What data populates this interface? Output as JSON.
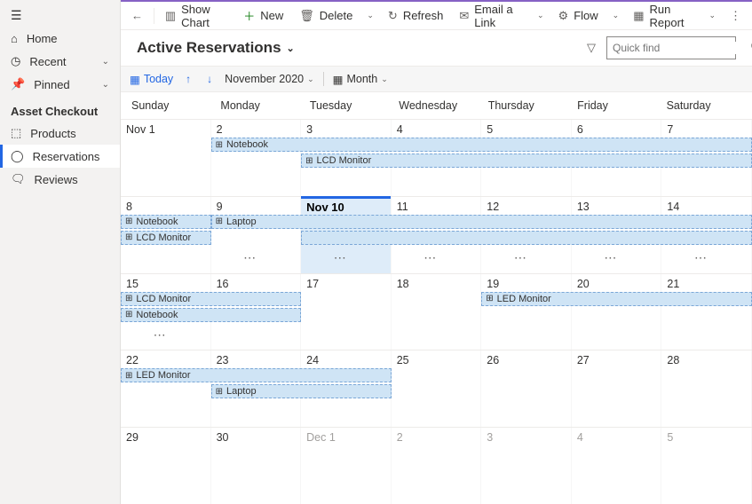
{
  "sidebar": {
    "top": [
      {
        "icon": "hamburger",
        "label": ""
      },
      {
        "icon": "home",
        "label": "Home"
      },
      {
        "icon": "clock",
        "label": "Recent",
        "expandable": true
      },
      {
        "icon": "pin",
        "label": "Pinned",
        "expandable": true
      }
    ],
    "section_title": "Asset Checkout",
    "items": [
      {
        "icon": "cube",
        "label": "Products"
      },
      {
        "icon": "check-circle",
        "label": "Reservations",
        "active": true
      },
      {
        "icon": "comment",
        "label": "Reviews"
      }
    ]
  },
  "commands": {
    "back": "←",
    "show_chart": "Show Chart",
    "new": "New",
    "delete": "Delete",
    "refresh": "Refresh",
    "email": "Email a Link",
    "flow": "Flow",
    "run_report": "Run Report"
  },
  "title": "Active Reservations",
  "search_placeholder": "Quick find",
  "calbar": {
    "today": "Today",
    "period": "November 2020",
    "view": "Month"
  },
  "day_headers": [
    "Sunday",
    "Monday",
    "Tuesday",
    "Wednesday",
    "Thursday",
    "Friday",
    "Saturday"
  ],
  "weeks": [
    {
      "cells": [
        {
          "label": "Nov 1"
        },
        {
          "label": "2"
        },
        {
          "label": "3"
        },
        {
          "label": "4"
        },
        {
          "label": "5"
        },
        {
          "label": "6"
        },
        {
          "label": "7"
        }
      ],
      "events": [
        {
          "label": "Notebook",
          "col_start": 1,
          "col_end": 7,
          "row": 0
        },
        {
          "label": "LCD Monitor",
          "col_start": 2,
          "col_end": 7,
          "row": 1
        }
      ]
    },
    {
      "cells": [
        {
          "label": "8"
        },
        {
          "label": "9"
        },
        {
          "label": "Nov 10",
          "today": true
        },
        {
          "label": "11"
        },
        {
          "label": "12"
        },
        {
          "label": "13"
        },
        {
          "label": "14"
        }
      ],
      "events": [
        {
          "label": "Notebook",
          "col_start": 0,
          "col_end": 1,
          "row": 0
        },
        {
          "label": "Laptop",
          "col_start": 1,
          "col_end": 7,
          "row": 0
        },
        {
          "label": "LCD Monitor",
          "col_start": 0,
          "col_end": 1,
          "row": 1
        },
        {
          "label": "",
          "col_start": 2,
          "col_end": 7,
          "row": 1,
          "blank": true
        }
      ],
      "more_cols": [
        1,
        2,
        3,
        4,
        5,
        6
      ]
    },
    {
      "cells": [
        {
          "label": "15"
        },
        {
          "label": "16"
        },
        {
          "label": "17"
        },
        {
          "label": "18"
        },
        {
          "label": "19"
        },
        {
          "label": "20"
        },
        {
          "label": "21"
        }
      ],
      "events": [
        {
          "label": "LCD Monitor",
          "col_start": 0,
          "col_end": 2,
          "row": 0
        },
        {
          "label": "LED Monitor",
          "col_start": 4,
          "col_end": 7,
          "row": 0
        },
        {
          "label": "Notebook",
          "col_start": 0,
          "col_end": 2,
          "row": 1
        }
      ],
      "more_cols": [
        0
      ]
    },
    {
      "cells": [
        {
          "label": "22"
        },
        {
          "label": "23"
        },
        {
          "label": "24"
        },
        {
          "label": "25"
        },
        {
          "label": "26"
        },
        {
          "label": "27"
        },
        {
          "label": "28"
        }
      ],
      "events": [
        {
          "label": "LED Monitor",
          "col_start": 0,
          "col_end": 3,
          "row": 0
        },
        {
          "label": "Laptop",
          "col_start": 1,
          "col_end": 3,
          "row": 1
        }
      ]
    },
    {
      "cells": [
        {
          "label": "29"
        },
        {
          "label": "30"
        },
        {
          "label": "Dec 1",
          "other": true
        },
        {
          "label": "2",
          "other": true
        },
        {
          "label": "3",
          "other": true
        },
        {
          "label": "4",
          "other": true
        },
        {
          "label": "5",
          "other": true
        }
      ],
      "events": []
    }
  ]
}
